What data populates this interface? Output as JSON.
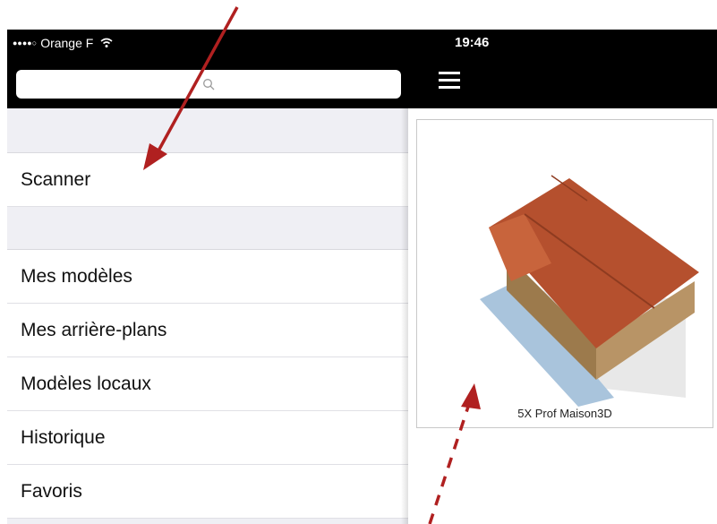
{
  "status": {
    "carrier": "Orange F",
    "time": "19:46"
  },
  "search": {
    "icon": "search-icon"
  },
  "menu": {
    "items": [
      {
        "label": "Scanner"
      },
      {
        "label": "Mes modèles"
      },
      {
        "label": "Mes arrière-plans"
      },
      {
        "label": "Modèles locaux"
      },
      {
        "label": "Historique"
      },
      {
        "label": "Favoris"
      }
    ]
  },
  "content": {
    "model": {
      "name": "5X Prof Maison3D"
    }
  },
  "colors": {
    "bar": "#000000",
    "arrow": "#b02020",
    "roof": "#b5502e",
    "wall": "#b08a5a",
    "ground": "#a9c4dc"
  }
}
